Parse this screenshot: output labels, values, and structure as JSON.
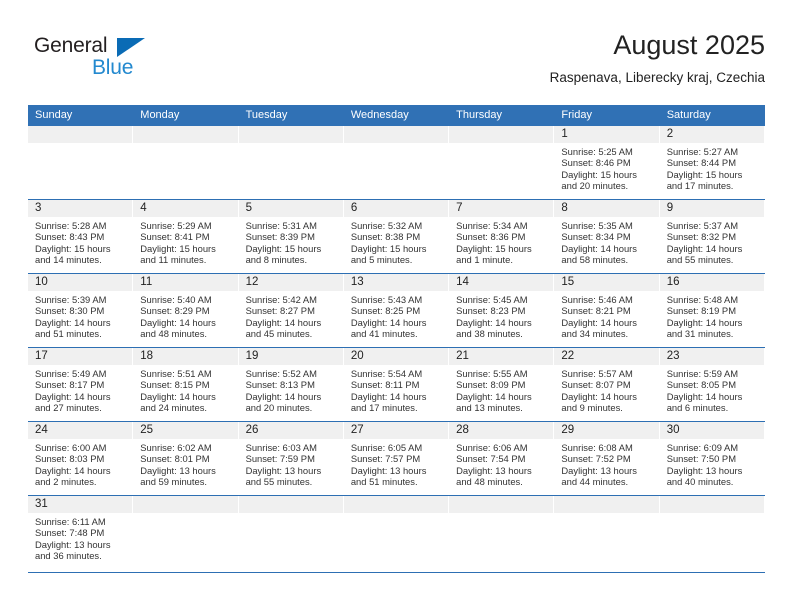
{
  "logo": {
    "word_top": "General",
    "word_bottom": "Blue",
    "triangle_icon": "triangle-icon",
    "color_dark": "#231f20",
    "color_blue": "#2389cf"
  },
  "header": {
    "month_title": "August 2025",
    "location": "Raspenava, Liberecky kraj, Czechia"
  },
  "theme": {
    "header_blue": "#3071b5",
    "separator_blue": "#2d6fb3",
    "daynum_band": "#f0f0f0"
  },
  "weekdays": [
    "Sunday",
    "Monday",
    "Tuesday",
    "Wednesday",
    "Thursday",
    "Friday",
    "Saturday"
  ],
  "weeks": [
    [
      {
        "day": "",
        "empty": true
      },
      {
        "day": "",
        "empty": true
      },
      {
        "day": "",
        "empty": true
      },
      {
        "day": "",
        "empty": true
      },
      {
        "day": "",
        "empty": true
      },
      {
        "day": "1",
        "sunrise": "Sunrise: 5:25 AM",
        "sunset": "Sunset: 8:46 PM",
        "daylight1": "Daylight: 15 hours",
        "daylight2": "and 20 minutes."
      },
      {
        "day": "2",
        "sunrise": "Sunrise: 5:27 AM",
        "sunset": "Sunset: 8:44 PM",
        "daylight1": "Daylight: 15 hours",
        "daylight2": "and 17 minutes."
      }
    ],
    [
      {
        "day": "3",
        "sunrise": "Sunrise: 5:28 AM",
        "sunset": "Sunset: 8:43 PM",
        "daylight1": "Daylight: 15 hours",
        "daylight2": "and 14 minutes."
      },
      {
        "day": "4",
        "sunrise": "Sunrise: 5:29 AM",
        "sunset": "Sunset: 8:41 PM",
        "daylight1": "Daylight: 15 hours",
        "daylight2": "and 11 minutes."
      },
      {
        "day": "5",
        "sunrise": "Sunrise: 5:31 AM",
        "sunset": "Sunset: 8:39 PM",
        "daylight1": "Daylight: 15 hours",
        "daylight2": "and 8 minutes."
      },
      {
        "day": "6",
        "sunrise": "Sunrise: 5:32 AM",
        "sunset": "Sunset: 8:38 PM",
        "daylight1": "Daylight: 15 hours",
        "daylight2": "and 5 minutes."
      },
      {
        "day": "7",
        "sunrise": "Sunrise: 5:34 AM",
        "sunset": "Sunset: 8:36 PM",
        "daylight1": "Daylight: 15 hours",
        "daylight2": "and 1 minute."
      },
      {
        "day": "8",
        "sunrise": "Sunrise: 5:35 AM",
        "sunset": "Sunset: 8:34 PM",
        "daylight1": "Daylight: 14 hours",
        "daylight2": "and 58 minutes."
      },
      {
        "day": "9",
        "sunrise": "Sunrise: 5:37 AM",
        "sunset": "Sunset: 8:32 PM",
        "daylight1": "Daylight: 14 hours",
        "daylight2": "and 55 minutes."
      }
    ],
    [
      {
        "day": "10",
        "sunrise": "Sunrise: 5:39 AM",
        "sunset": "Sunset: 8:30 PM",
        "daylight1": "Daylight: 14 hours",
        "daylight2": "and 51 minutes."
      },
      {
        "day": "11",
        "sunrise": "Sunrise: 5:40 AM",
        "sunset": "Sunset: 8:29 PM",
        "daylight1": "Daylight: 14 hours",
        "daylight2": "and 48 minutes."
      },
      {
        "day": "12",
        "sunrise": "Sunrise: 5:42 AM",
        "sunset": "Sunset: 8:27 PM",
        "daylight1": "Daylight: 14 hours",
        "daylight2": "and 45 minutes."
      },
      {
        "day": "13",
        "sunrise": "Sunrise: 5:43 AM",
        "sunset": "Sunset: 8:25 PM",
        "daylight1": "Daylight: 14 hours",
        "daylight2": "and 41 minutes."
      },
      {
        "day": "14",
        "sunrise": "Sunrise: 5:45 AM",
        "sunset": "Sunset: 8:23 PM",
        "daylight1": "Daylight: 14 hours",
        "daylight2": "and 38 minutes."
      },
      {
        "day": "15",
        "sunrise": "Sunrise: 5:46 AM",
        "sunset": "Sunset: 8:21 PM",
        "daylight1": "Daylight: 14 hours",
        "daylight2": "and 34 minutes."
      },
      {
        "day": "16",
        "sunrise": "Sunrise: 5:48 AM",
        "sunset": "Sunset: 8:19 PM",
        "daylight1": "Daylight: 14 hours",
        "daylight2": "and 31 minutes."
      }
    ],
    [
      {
        "day": "17",
        "sunrise": "Sunrise: 5:49 AM",
        "sunset": "Sunset: 8:17 PM",
        "daylight1": "Daylight: 14 hours",
        "daylight2": "and 27 minutes."
      },
      {
        "day": "18",
        "sunrise": "Sunrise: 5:51 AM",
        "sunset": "Sunset: 8:15 PM",
        "daylight1": "Daylight: 14 hours",
        "daylight2": "and 24 minutes."
      },
      {
        "day": "19",
        "sunrise": "Sunrise: 5:52 AM",
        "sunset": "Sunset: 8:13 PM",
        "daylight1": "Daylight: 14 hours",
        "daylight2": "and 20 minutes."
      },
      {
        "day": "20",
        "sunrise": "Sunrise: 5:54 AM",
        "sunset": "Sunset: 8:11 PM",
        "daylight1": "Daylight: 14 hours",
        "daylight2": "and 17 minutes."
      },
      {
        "day": "21",
        "sunrise": "Sunrise: 5:55 AM",
        "sunset": "Sunset: 8:09 PM",
        "daylight1": "Daylight: 14 hours",
        "daylight2": "and 13 minutes."
      },
      {
        "day": "22",
        "sunrise": "Sunrise: 5:57 AM",
        "sunset": "Sunset: 8:07 PM",
        "daylight1": "Daylight: 14 hours",
        "daylight2": "and 9 minutes."
      },
      {
        "day": "23",
        "sunrise": "Sunrise: 5:59 AM",
        "sunset": "Sunset: 8:05 PM",
        "daylight1": "Daylight: 14 hours",
        "daylight2": "and 6 minutes."
      }
    ],
    [
      {
        "day": "24",
        "sunrise": "Sunrise: 6:00 AM",
        "sunset": "Sunset: 8:03 PM",
        "daylight1": "Daylight: 14 hours",
        "daylight2": "and 2 minutes."
      },
      {
        "day": "25",
        "sunrise": "Sunrise: 6:02 AM",
        "sunset": "Sunset: 8:01 PM",
        "daylight1": "Daylight: 13 hours",
        "daylight2": "and 59 minutes."
      },
      {
        "day": "26",
        "sunrise": "Sunrise: 6:03 AM",
        "sunset": "Sunset: 7:59 PM",
        "daylight1": "Daylight: 13 hours",
        "daylight2": "and 55 minutes."
      },
      {
        "day": "27",
        "sunrise": "Sunrise: 6:05 AM",
        "sunset": "Sunset: 7:57 PM",
        "daylight1": "Daylight: 13 hours",
        "daylight2": "and 51 minutes."
      },
      {
        "day": "28",
        "sunrise": "Sunrise: 6:06 AM",
        "sunset": "Sunset: 7:54 PM",
        "daylight1": "Daylight: 13 hours",
        "daylight2": "and 48 minutes."
      },
      {
        "day": "29",
        "sunrise": "Sunrise: 6:08 AM",
        "sunset": "Sunset: 7:52 PM",
        "daylight1": "Daylight: 13 hours",
        "daylight2": "and 44 minutes."
      },
      {
        "day": "30",
        "sunrise": "Sunrise: 6:09 AM",
        "sunset": "Sunset: 7:50 PM",
        "daylight1": "Daylight: 13 hours",
        "daylight2": "and 40 minutes."
      }
    ],
    [
      {
        "day": "31",
        "sunrise": "Sunrise: 6:11 AM",
        "sunset": "Sunset: 7:48 PM",
        "daylight1": "Daylight: 13 hours",
        "daylight2": "and 36 minutes."
      },
      {
        "day": "",
        "empty": true
      },
      {
        "day": "",
        "empty": true
      },
      {
        "day": "",
        "empty": true
      },
      {
        "day": "",
        "empty": true
      },
      {
        "day": "",
        "empty": true
      },
      {
        "day": "",
        "empty": true
      }
    ]
  ]
}
